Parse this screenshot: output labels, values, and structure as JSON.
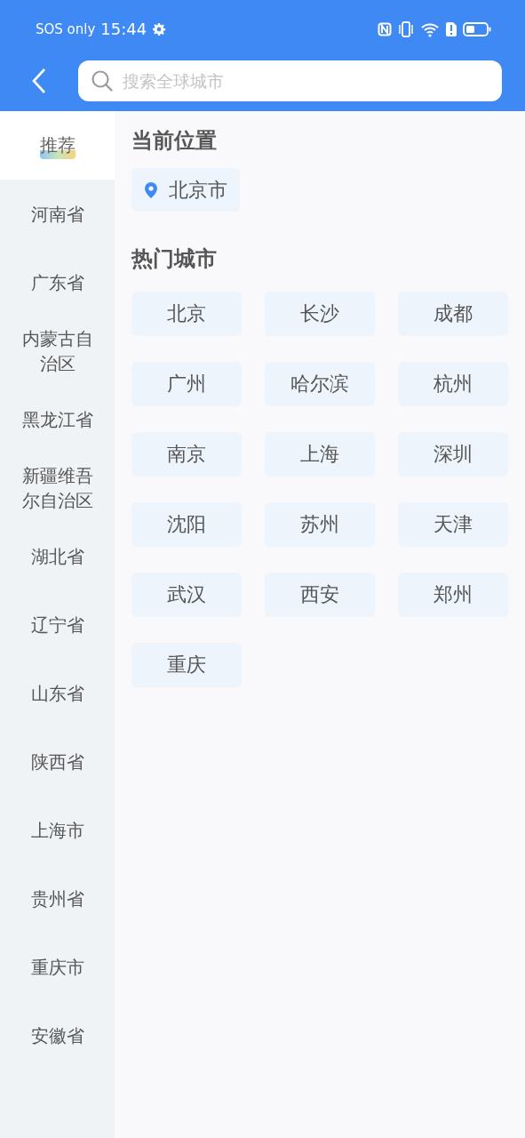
{
  "status_bar": {
    "carrier": "SOS only",
    "time": "15:44"
  },
  "search": {
    "placeholder": "搜索全球城市"
  },
  "sidebar": {
    "items": [
      {
        "label": "推荐",
        "selected": true
      },
      {
        "label": "河南省",
        "selected": false
      },
      {
        "label": "广东省",
        "selected": false
      },
      {
        "label": "内蒙古自治区",
        "selected": false
      },
      {
        "label": "黑龙江省",
        "selected": false
      },
      {
        "label": "新疆维吾尔自治区",
        "selected": false
      },
      {
        "label": "湖北省",
        "selected": false
      },
      {
        "label": "辽宁省",
        "selected": false
      },
      {
        "label": "山东省",
        "selected": false
      },
      {
        "label": "陕西省",
        "selected": false
      },
      {
        "label": "上海市",
        "selected": false
      },
      {
        "label": "贵州省",
        "selected": false
      },
      {
        "label": "重庆市",
        "selected": false
      },
      {
        "label": "安徽省",
        "selected": false
      }
    ]
  },
  "current_location": {
    "title": "当前位置",
    "city": "北京市"
  },
  "hot_cities": {
    "title": "热门城市",
    "cities": [
      "北京",
      "长沙",
      "成都",
      "广州",
      "哈尔滨",
      "杭州",
      "南京",
      "上海",
      "深圳",
      "沈阳",
      "苏州",
      "天津",
      "武汉",
      "西安",
      "郑州",
      "重庆"
    ]
  }
}
